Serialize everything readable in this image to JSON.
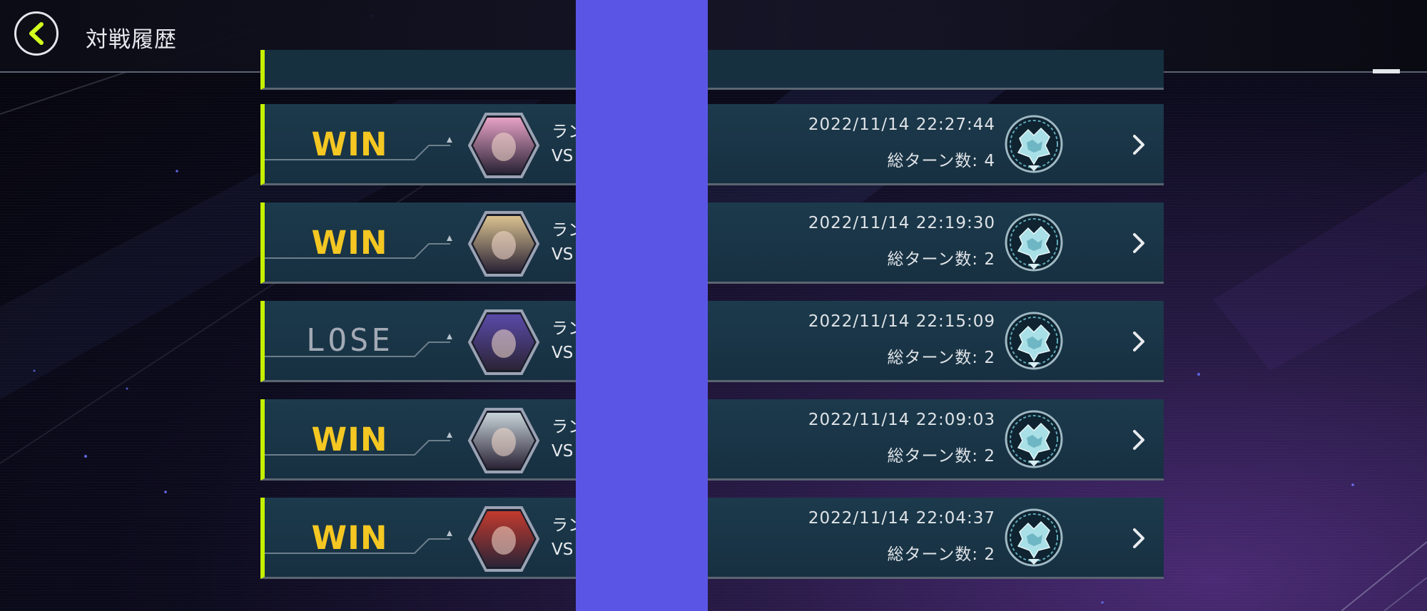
{
  "header": {
    "title": "対戦履歴"
  },
  "labels": {
    "turns_prefix": "総ターン数: ",
    "duel_line1": "ラン",
    "duel_line2": "VS"
  },
  "colors": {
    "accent": "#c5f000",
    "win": "#f4c722",
    "lose": "#a3aab5",
    "row_bg": "#1c3a4c",
    "mask": "#5b55e6"
  },
  "rows": [
    {
      "result": "WIN",
      "result_type": "win",
      "timestamp": "2022/11/14 22:27:44",
      "turns_text": "総ターン数: 4",
      "avatar": "pink-hair-character-avatar",
      "avatar_color": "#e6a2c6"
    },
    {
      "result": "WIN",
      "result_type": "win",
      "timestamp": "2022/11/14 22:19:30",
      "turns_text": "総ターン数: 2",
      "avatar": "blonde-character-avatar",
      "avatar_color": "#d9c190"
    },
    {
      "result": "LOSE",
      "result_type": "lose",
      "timestamp": "2022/11/14 22:15:09",
      "turns_text": "総ターン数: 2",
      "avatar": "blue-hair-character-avatar",
      "avatar_color": "#5a4aa8"
    },
    {
      "result": "WIN",
      "result_type": "win",
      "timestamp": "2022/11/14 22:09:03",
      "turns_text": "総ターン数: 2",
      "avatar": "white-hair-character-avatar",
      "avatar_color": "#c7d3d8"
    },
    {
      "result": "WIN",
      "result_type": "win",
      "timestamp": "2022/11/14 22:04:37",
      "turns_text": "総ターン数: 2",
      "avatar": "red-cap-character-avatar",
      "avatar_color": "#c23a2e"
    }
  ]
}
